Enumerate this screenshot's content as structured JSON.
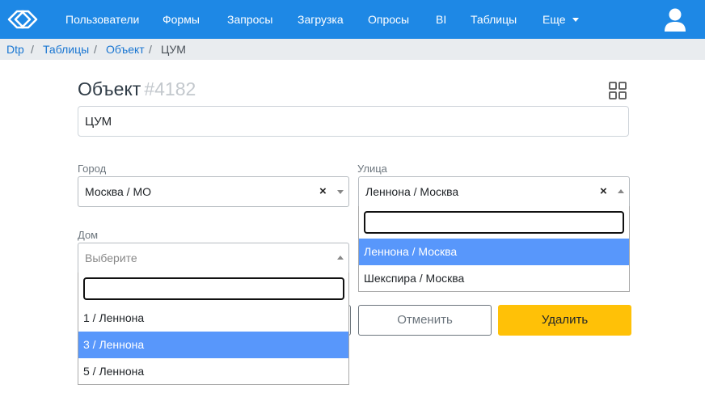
{
  "navbar": {
    "logo_icon": "logo-icon",
    "items": [
      "Пользователи",
      "Формы",
      "Запросы",
      "Загрузка",
      "Опросы",
      "BI",
      "Таблицы"
    ],
    "more_label": "Еще",
    "user_icon": "user-icon",
    "color": "#1e88e5"
  },
  "breadcrumb": {
    "items": [
      "Dtp",
      "Таблицы",
      "Объект"
    ],
    "separator": "/",
    "current": "ЦУМ"
  },
  "page": {
    "title": "Объект",
    "id_label": "#4182",
    "grid_icon": "grid-icon"
  },
  "form": {
    "name_value": "ЦУМ",
    "city": {
      "label": "Город",
      "value": "Москва / МО",
      "clear": "×"
    },
    "street": {
      "label": "Улица",
      "value": "Леннона / Москва",
      "clear": "×",
      "search_value": "",
      "options": [
        "Леннона / Москва",
        "Шекспира / Москва"
      ],
      "highlighted_index": 0
    },
    "house": {
      "label": "Дом",
      "placeholder": "Выберите",
      "search_value": "",
      "options": [
        "1 / Леннона",
        "3 / Леннона",
        "5 / Леннона"
      ],
      "highlighted_index": 1
    },
    "cancel_label": "Отменить",
    "delete_label": "Удалить"
  },
  "colors": {
    "accent": "#1e88e5",
    "highlight": "#5897fb",
    "delete": "#ffc107"
  }
}
